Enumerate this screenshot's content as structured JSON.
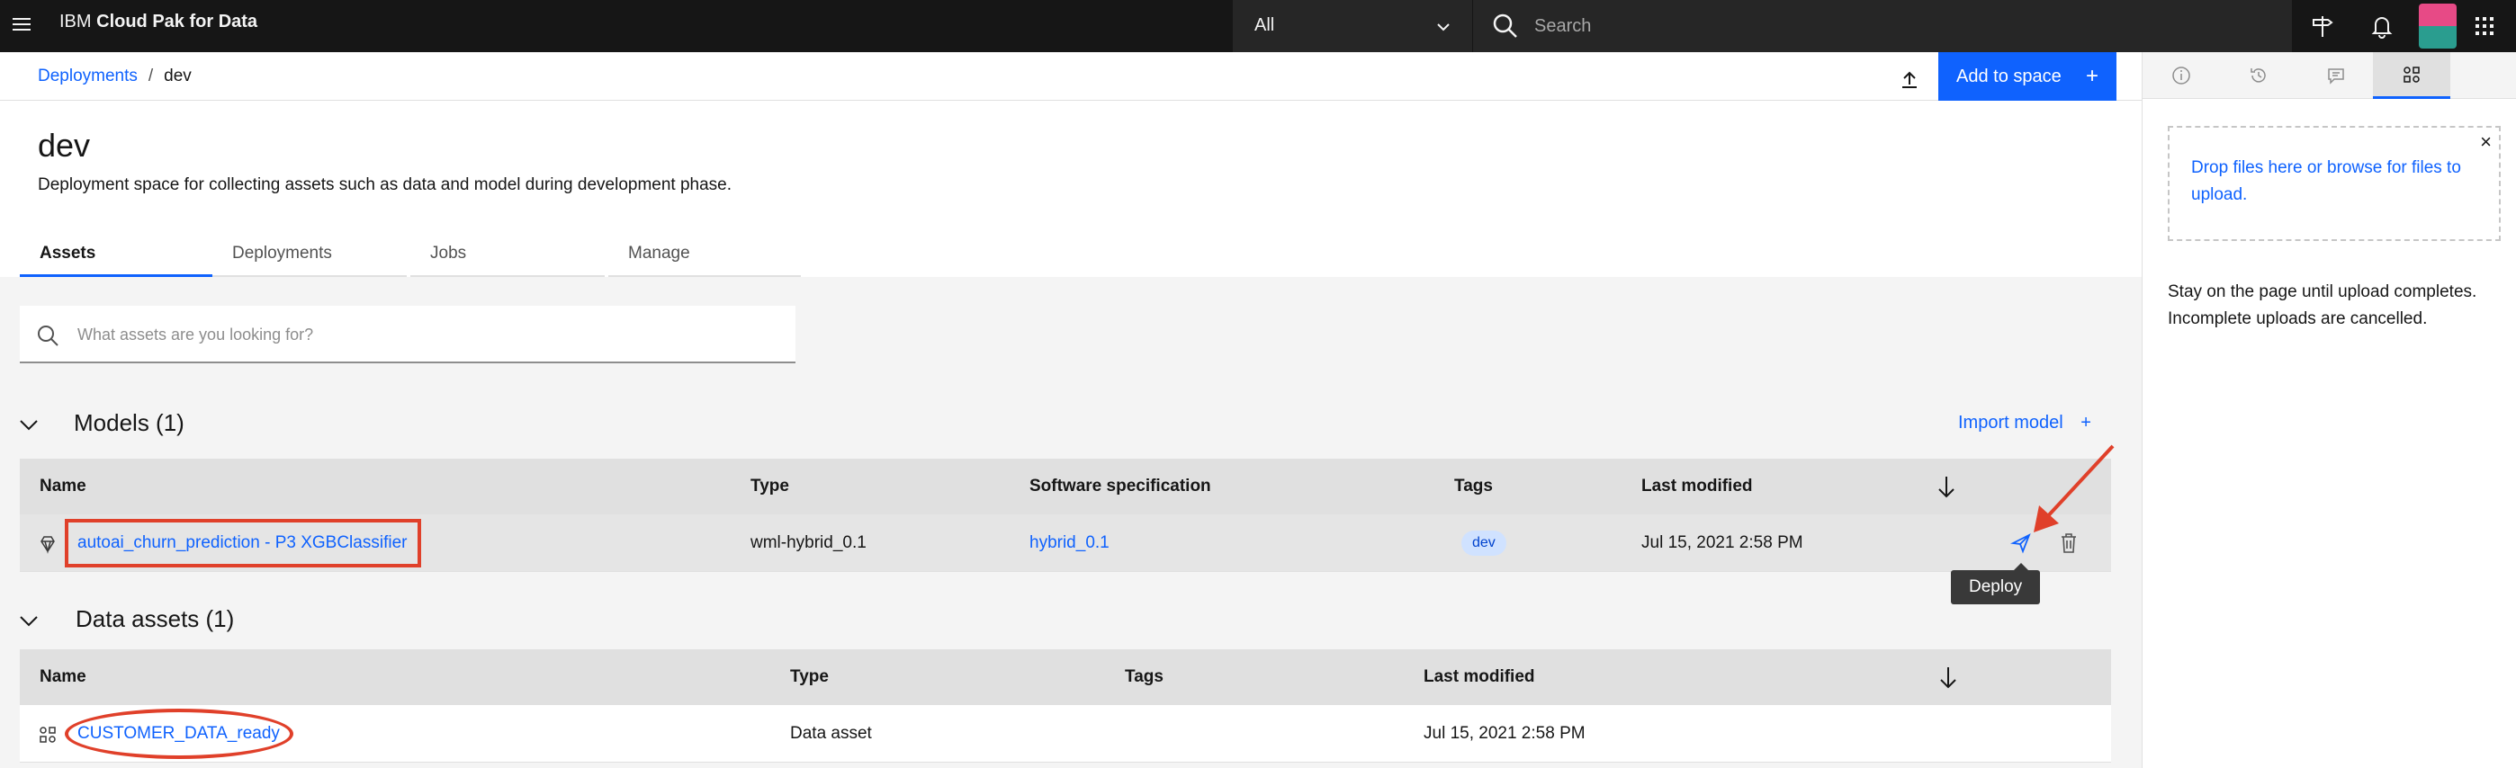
{
  "header": {
    "brand_prefix": "IBM ",
    "brand_name": "Cloud Pak for Data",
    "scope_selected": "All",
    "search_placeholder": "Search",
    "avatar_colors": [
      "#e74a86",
      "#2a9d8f"
    ]
  },
  "breadcrumb": {
    "items": [
      {
        "label": "Deployments",
        "link": true
      },
      {
        "label": "dev",
        "link": false
      }
    ],
    "separator": "/"
  },
  "toolbar": {
    "add_to_space_label": "Add to space",
    "add_icon": "+"
  },
  "space": {
    "title": "dev",
    "description": "Deployment space for collecting assets such as data and model during development phase."
  },
  "tabs": [
    {
      "label": "Assets",
      "active": true
    },
    {
      "label": "Deployments",
      "active": false
    },
    {
      "label": "Jobs",
      "active": false
    },
    {
      "label": "Manage",
      "active": false
    }
  ],
  "asset_search": {
    "placeholder": "What assets are you looking for?"
  },
  "models": {
    "title": "Models (1)",
    "import_label": "Import model",
    "import_icon": "+",
    "columns": [
      "Name",
      "Type",
      "Software specification",
      "Tags",
      "Last modified"
    ],
    "rows": [
      {
        "name": "autoai_churn_prediction - P3 XGBClassifier",
        "type": "wml-hybrid_0.1",
        "software_spec": "hybrid_0.1",
        "tag": "dev",
        "last_modified": "Jul 15, 2021 2:58 PM"
      }
    ],
    "deploy_tooltip": "Deploy"
  },
  "data_assets": {
    "title": "Data assets (1)",
    "columns": [
      "Name",
      "Type",
      "Tags",
      "Last modified"
    ],
    "rows": [
      {
        "name": "CUSTOMER_DATA_ready",
        "type": "Data asset",
        "last_modified": "Jul 15, 2021 2:58 PM"
      }
    ]
  },
  "right_panel": {
    "dropzone_text": "Drop files here or browse for files to upload.",
    "close_symbol": "×",
    "note": "Stay on the page until upload completes. Incomplete uploads are cancelled."
  },
  "colors": {
    "primary": "#0f62fe",
    "annotation": "#e0402a",
    "topbar": "#161616"
  }
}
